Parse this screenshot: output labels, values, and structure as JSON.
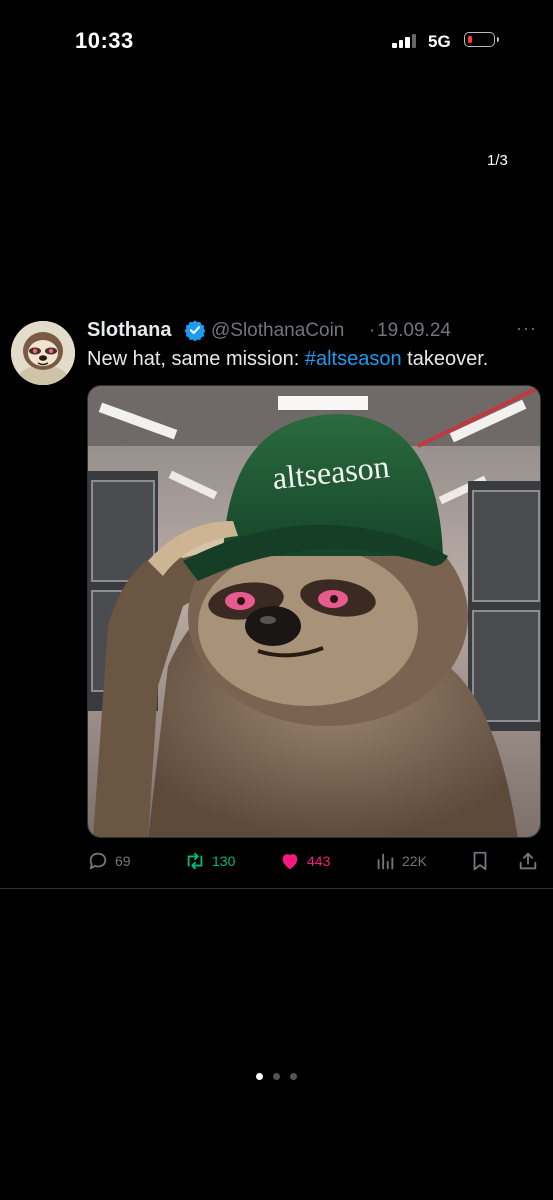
{
  "status": {
    "time": "10:33",
    "network": "5G",
    "battery_color": "#ff3b30"
  },
  "viewer": {
    "counter": "1/3",
    "carousel_dots": 3,
    "active_dot": 0
  },
  "tweet": {
    "display_name": "Slothana",
    "verified": true,
    "handle": "@SlothanaCoin",
    "separator": "·",
    "date": "19.09.24",
    "more_icon": "more-horizontal-icon",
    "text_before": "New hat, same mission: ",
    "hashtag": "#altseason",
    "text_after": " takeover.",
    "image": {
      "cap_text": "altseason",
      "cap_color": "#1f5a33"
    },
    "stats": {
      "replies": "69",
      "retweets": "130",
      "likes": "443",
      "views": "22K"
    },
    "colors": {
      "accent": "#1d9bf0",
      "retweet": "#00ba7c",
      "like": "#f91880",
      "muted": "#71767b"
    }
  }
}
